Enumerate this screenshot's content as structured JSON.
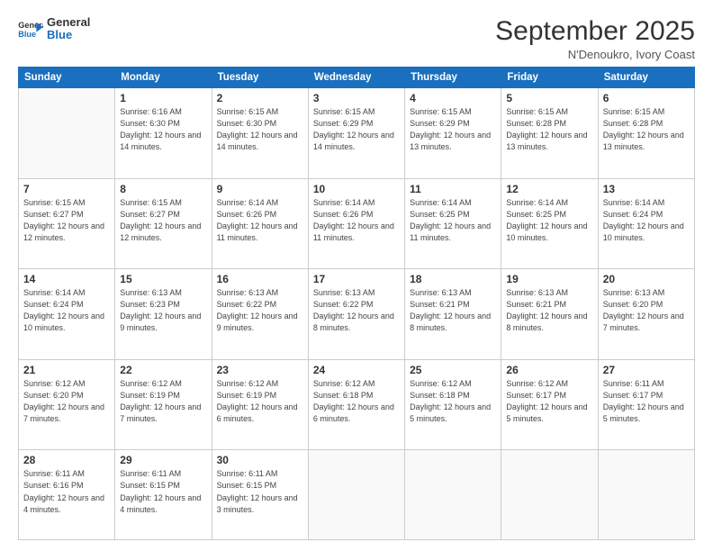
{
  "logo": {
    "line1": "General",
    "line2": "Blue"
  },
  "title": "September 2025",
  "subtitle": "N'Denoukro, Ivory Coast",
  "days_of_week": [
    "Sunday",
    "Monday",
    "Tuesday",
    "Wednesday",
    "Thursday",
    "Friday",
    "Saturday"
  ],
  "weeks": [
    [
      {
        "day": null,
        "info": null
      },
      {
        "day": "1",
        "info": "Sunrise: 6:16 AM\nSunset: 6:30 PM\nDaylight: 12 hours\nand 14 minutes."
      },
      {
        "day": "2",
        "info": "Sunrise: 6:15 AM\nSunset: 6:30 PM\nDaylight: 12 hours\nand 14 minutes."
      },
      {
        "day": "3",
        "info": "Sunrise: 6:15 AM\nSunset: 6:29 PM\nDaylight: 12 hours\nand 14 minutes."
      },
      {
        "day": "4",
        "info": "Sunrise: 6:15 AM\nSunset: 6:29 PM\nDaylight: 12 hours\nand 13 minutes."
      },
      {
        "day": "5",
        "info": "Sunrise: 6:15 AM\nSunset: 6:28 PM\nDaylight: 12 hours\nand 13 minutes."
      },
      {
        "day": "6",
        "info": "Sunrise: 6:15 AM\nSunset: 6:28 PM\nDaylight: 12 hours\nand 13 minutes."
      }
    ],
    [
      {
        "day": "7",
        "info": "Sunrise: 6:15 AM\nSunset: 6:27 PM\nDaylight: 12 hours\nand 12 minutes."
      },
      {
        "day": "8",
        "info": "Sunrise: 6:15 AM\nSunset: 6:27 PM\nDaylight: 12 hours\nand 12 minutes."
      },
      {
        "day": "9",
        "info": "Sunrise: 6:14 AM\nSunset: 6:26 PM\nDaylight: 12 hours\nand 11 minutes."
      },
      {
        "day": "10",
        "info": "Sunrise: 6:14 AM\nSunset: 6:26 PM\nDaylight: 12 hours\nand 11 minutes."
      },
      {
        "day": "11",
        "info": "Sunrise: 6:14 AM\nSunset: 6:25 PM\nDaylight: 12 hours\nand 11 minutes."
      },
      {
        "day": "12",
        "info": "Sunrise: 6:14 AM\nSunset: 6:25 PM\nDaylight: 12 hours\nand 10 minutes."
      },
      {
        "day": "13",
        "info": "Sunrise: 6:14 AM\nSunset: 6:24 PM\nDaylight: 12 hours\nand 10 minutes."
      }
    ],
    [
      {
        "day": "14",
        "info": "Sunrise: 6:14 AM\nSunset: 6:24 PM\nDaylight: 12 hours\nand 10 minutes."
      },
      {
        "day": "15",
        "info": "Sunrise: 6:13 AM\nSunset: 6:23 PM\nDaylight: 12 hours\nand 9 minutes."
      },
      {
        "day": "16",
        "info": "Sunrise: 6:13 AM\nSunset: 6:22 PM\nDaylight: 12 hours\nand 9 minutes."
      },
      {
        "day": "17",
        "info": "Sunrise: 6:13 AM\nSunset: 6:22 PM\nDaylight: 12 hours\nand 8 minutes."
      },
      {
        "day": "18",
        "info": "Sunrise: 6:13 AM\nSunset: 6:21 PM\nDaylight: 12 hours\nand 8 minutes."
      },
      {
        "day": "19",
        "info": "Sunrise: 6:13 AM\nSunset: 6:21 PM\nDaylight: 12 hours\nand 8 minutes."
      },
      {
        "day": "20",
        "info": "Sunrise: 6:13 AM\nSunset: 6:20 PM\nDaylight: 12 hours\nand 7 minutes."
      }
    ],
    [
      {
        "day": "21",
        "info": "Sunrise: 6:12 AM\nSunset: 6:20 PM\nDaylight: 12 hours\nand 7 minutes."
      },
      {
        "day": "22",
        "info": "Sunrise: 6:12 AM\nSunset: 6:19 PM\nDaylight: 12 hours\nand 7 minutes."
      },
      {
        "day": "23",
        "info": "Sunrise: 6:12 AM\nSunset: 6:19 PM\nDaylight: 12 hours\nand 6 minutes."
      },
      {
        "day": "24",
        "info": "Sunrise: 6:12 AM\nSunset: 6:18 PM\nDaylight: 12 hours\nand 6 minutes."
      },
      {
        "day": "25",
        "info": "Sunrise: 6:12 AM\nSunset: 6:18 PM\nDaylight: 12 hours\nand 5 minutes."
      },
      {
        "day": "26",
        "info": "Sunrise: 6:12 AM\nSunset: 6:17 PM\nDaylight: 12 hours\nand 5 minutes."
      },
      {
        "day": "27",
        "info": "Sunrise: 6:11 AM\nSunset: 6:17 PM\nDaylight: 12 hours\nand 5 minutes."
      }
    ],
    [
      {
        "day": "28",
        "info": "Sunrise: 6:11 AM\nSunset: 6:16 PM\nDaylight: 12 hours\nand 4 minutes."
      },
      {
        "day": "29",
        "info": "Sunrise: 6:11 AM\nSunset: 6:15 PM\nDaylight: 12 hours\nand 4 minutes."
      },
      {
        "day": "30",
        "info": "Sunrise: 6:11 AM\nSunset: 6:15 PM\nDaylight: 12 hours\nand 3 minutes."
      },
      {
        "day": null,
        "info": null
      },
      {
        "day": null,
        "info": null
      },
      {
        "day": null,
        "info": null
      },
      {
        "day": null,
        "info": null
      }
    ]
  ]
}
